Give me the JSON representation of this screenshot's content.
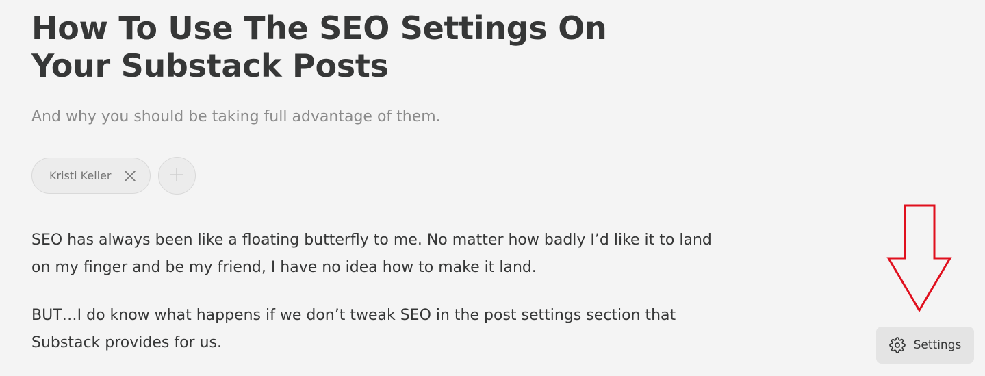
{
  "post": {
    "title": "How To Use The SEO Settings On Your Substack Posts",
    "subtitle": "And why you should be taking full advantage of them.",
    "author": {
      "name": "Kristi Keller",
      "remove_icon": "close-icon"
    },
    "add_author_icon": "plus-icon",
    "paragraphs": [
      "SEO has always been like a floating butterfly to me.  No matter how badly I’d like it to land on my finger and be my friend, I have no idea how to make it land.",
      "BUT…I do know what happens if we don’t tweak SEO in the post settings section that Substack provides for us."
    ]
  },
  "settings_button": {
    "label": "Settings",
    "icon": "gear-icon"
  },
  "annotation": {
    "arrow_color": "#e0101e",
    "arrow_direction": "down"
  },
  "colors": {
    "background": "#f4f4f4",
    "text": "#363737",
    "muted_text": "#8a8a8a"
  }
}
